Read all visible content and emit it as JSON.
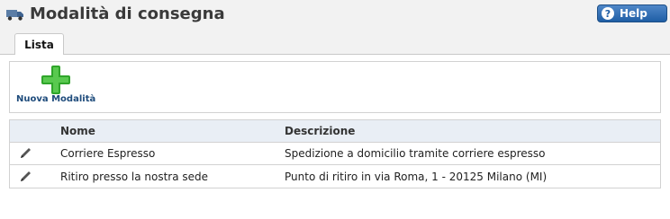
{
  "header": {
    "title": "Modalità di consegna",
    "title_icon": "truck-icon",
    "help_label": "Help",
    "help_icon": "question-icon",
    "accent_color": "#1f5ea5"
  },
  "tabs": [
    {
      "label": "Lista",
      "active": true
    }
  ],
  "toolbar": {
    "new_label": "Nuova Modalità",
    "new_icon": "plus-icon",
    "new_icon_color": "#2fa52a"
  },
  "table": {
    "columns": [
      "Nome",
      "Descrizione"
    ],
    "rows": [
      {
        "nome": "Corriere Espresso",
        "descrizione": "Spedizione a domicilio tramite corriere espresso",
        "action_icon": "edit-pencil-icon"
      },
      {
        "nome": "Ritiro presso la nostra sede",
        "descrizione": "Punto di ritiro in via Roma, 1 - 20125 Milano (MI)",
        "action_icon": "edit-pencil-icon"
      }
    ]
  }
}
